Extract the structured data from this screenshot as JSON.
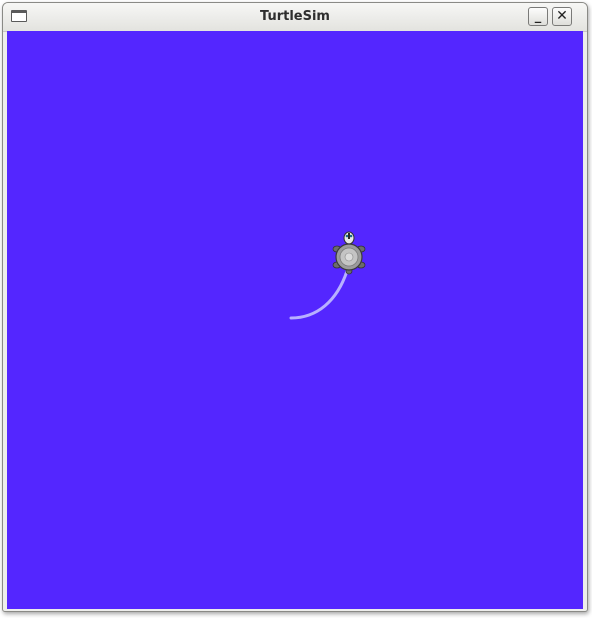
{
  "window": {
    "title": "TurtleSim",
    "menu_icon": "window-menu-icon",
    "minimize_label": "_",
    "close_label": "✕"
  },
  "canvas": {
    "background_color": "#5426ff",
    "pen_color": "#b8b0ff"
  },
  "turtle": {
    "icon": "turtle-icon"
  }
}
